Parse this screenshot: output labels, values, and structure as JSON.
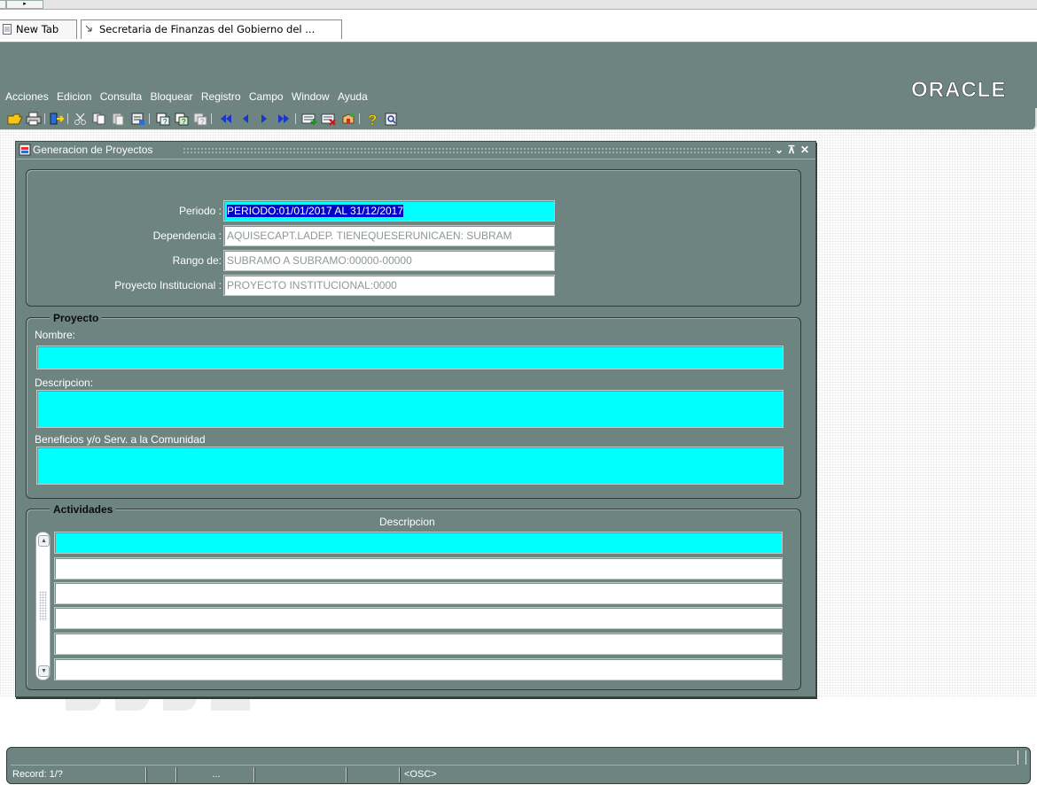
{
  "browser": {
    "tabs": [
      {
        "label": "New Tab"
      },
      {
        "label": "Secretaria de Finanzas del Gobierno del ..."
      }
    ]
  },
  "menubar": {
    "items": [
      {
        "label": "Acciones"
      },
      {
        "label": "Edicion"
      },
      {
        "label": "Consulta"
      },
      {
        "label": "Bloquear"
      },
      {
        "label": "Registro"
      },
      {
        "label": "Campo"
      },
      {
        "label": "Window"
      },
      {
        "label": "Ayuda"
      }
    ],
    "logo": "ORACLE"
  },
  "toolbar": {
    "buttons": [
      "open-icon",
      "print-icon",
      "exit-icon",
      "cut-icon",
      "copy-icon",
      "paste-icon",
      "clear-icon",
      "enter-query-icon",
      "execute-query-icon",
      "cancel-query-icon",
      "first-record-icon",
      "previous-record-icon",
      "next-record-icon",
      "last-record-icon",
      "insert-record-icon",
      "delete-record-icon",
      "save-icon",
      "help-icon",
      "find-icon"
    ]
  },
  "form": {
    "title": "Generacion de Proyectos",
    "header": {
      "periodo_label": "Periodo :",
      "periodo_value": "PERIODO:01/01/2017 AL 31/12/2017",
      "dependencia_label": "Dependencia :",
      "dependencia_value": "AQUISECAPT.LADEP. TIENEQUESERUNICAEN: SUBRAM",
      "rango_label": "Rango de:",
      "rango_value": "SUBRAMO A SUBRAMO:00000-00000",
      "proyecto_inst_label": "Proyecto Institucional :",
      "proyecto_inst_value": "PROYECTO INSTITUCIONAL:0000"
    },
    "proyecto": {
      "group_label": "Proyecto",
      "nombre_label": "Nombre:",
      "nombre_value": "",
      "descripcion_label": "Descripcion:",
      "descripcion_value": "",
      "beneficios_label": "Beneficios y/o Serv. a la Comunidad",
      "beneficios_value": ""
    },
    "actividades": {
      "group_label": "Actividades",
      "column_header": "Descripcion",
      "rows": [
        "",
        "",
        "",
        "",
        "",
        ""
      ]
    }
  },
  "statusbar": {
    "record": "Record: 1/?",
    "cell2": "",
    "cell3": "...",
    "cell4": "",
    "mode": "<OSC>"
  },
  "colors": {
    "forms_bg": "#6e8480",
    "current_field": "#00ffff",
    "selection": "#0000cc"
  }
}
